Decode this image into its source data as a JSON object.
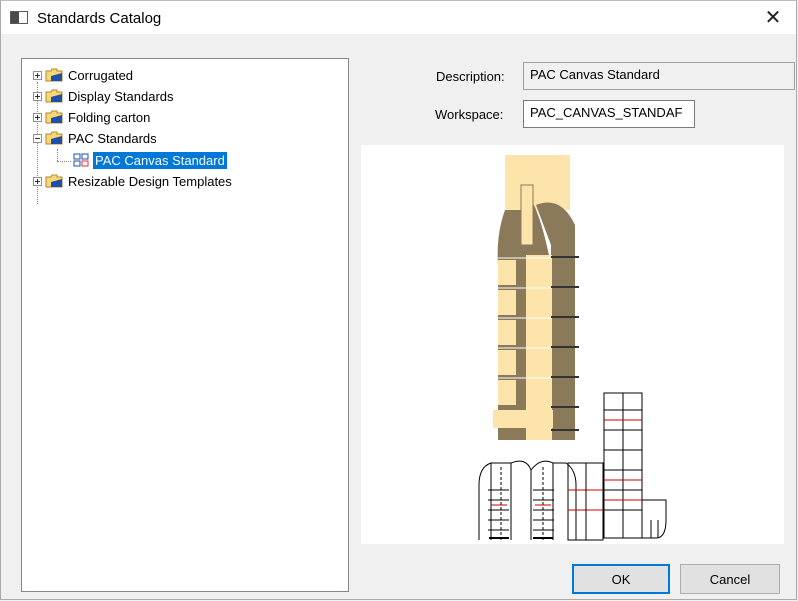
{
  "window": {
    "title": "Standards Catalog",
    "close_glyph": "✕"
  },
  "tree": {
    "items": [
      {
        "label": "Corrugated",
        "icon": "folder-icon",
        "expander": "plus"
      },
      {
        "label": "Display Standards",
        "icon": "folder-icon",
        "expander": "plus"
      },
      {
        "label": "Folding carton",
        "icon": "folder-icon",
        "expander": "plus"
      },
      {
        "label": "PAC Standards",
        "icon": "folder-icon",
        "expander": "minus"
      },
      {
        "label": "PAC Canvas Standard",
        "icon": "design-icon",
        "selected": true
      },
      {
        "label": "Resizable Design Templates",
        "icon": "folder-icon",
        "expander": "plus"
      }
    ]
  },
  "details": {
    "description_label": "Description:",
    "description_value": "PAC Canvas Standard",
    "workspace_label": "Workspace:",
    "workspace_value": "PAC_CANVAS_STANDAF"
  },
  "buttons": {
    "ok": "OK",
    "cancel": "Cancel"
  },
  "colors": {
    "selection": "#0078d7",
    "panel_light": "#fde4ab",
    "panel_dark": "#8b7a5a"
  }
}
